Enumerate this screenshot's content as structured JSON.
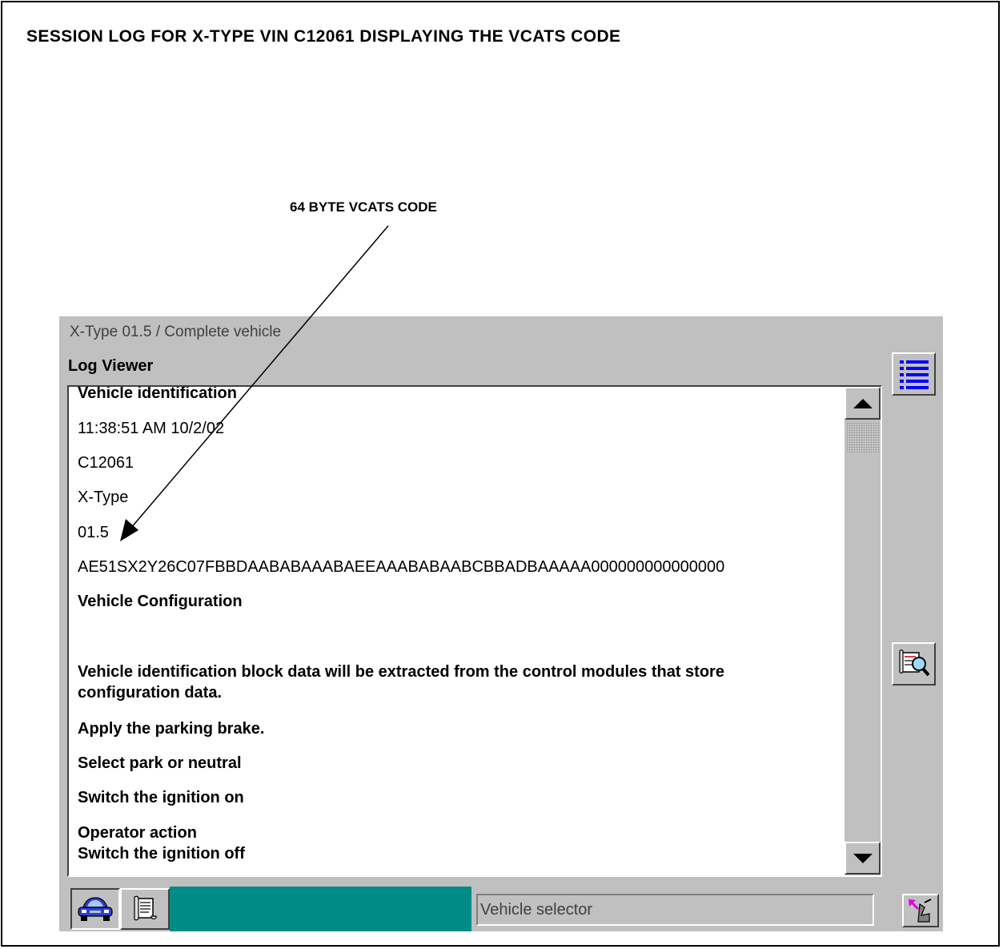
{
  "document": {
    "title": "SESSION LOG FOR X-TYPE VIN C12061 DISPLAYING THE VCATS CODE",
    "callout_label": "64 BYTE VCATS CODE"
  },
  "app": {
    "breadcrumb": "X-Type 01.5 / Complete vehicle",
    "panel_title": "Log Viewer",
    "log_lines": [
      "Vehicle identification",
      "11:38:51 AM 10/2/02",
      "C12061",
      "X-Type",
      "01.5",
      "AE51SX2Y26C07FBBDAABABAAABAEEAAABABAABCBBADBAAAAA000000000000000",
      "Vehicle Configuration",
      "Vehicle identification block data will be extracted from the control modules that store configuration data.",
      "Apply the parking brake.",
      "Select park or neutral",
      "Switch the ignition on",
      "Operator action",
      "Switch the ignition off"
    ],
    "status_field": "Vehicle selector",
    "icons": {
      "list": "list-icon",
      "log_search": "log-search-icon",
      "vehicle": "car-icon",
      "scroll": "scroll-icon",
      "corner": "tool-icon"
    },
    "colors": {
      "panel": "#c0c0c0",
      "taskbar_teal": "#008b87",
      "list_icon_blue": "#0000ff"
    }
  }
}
